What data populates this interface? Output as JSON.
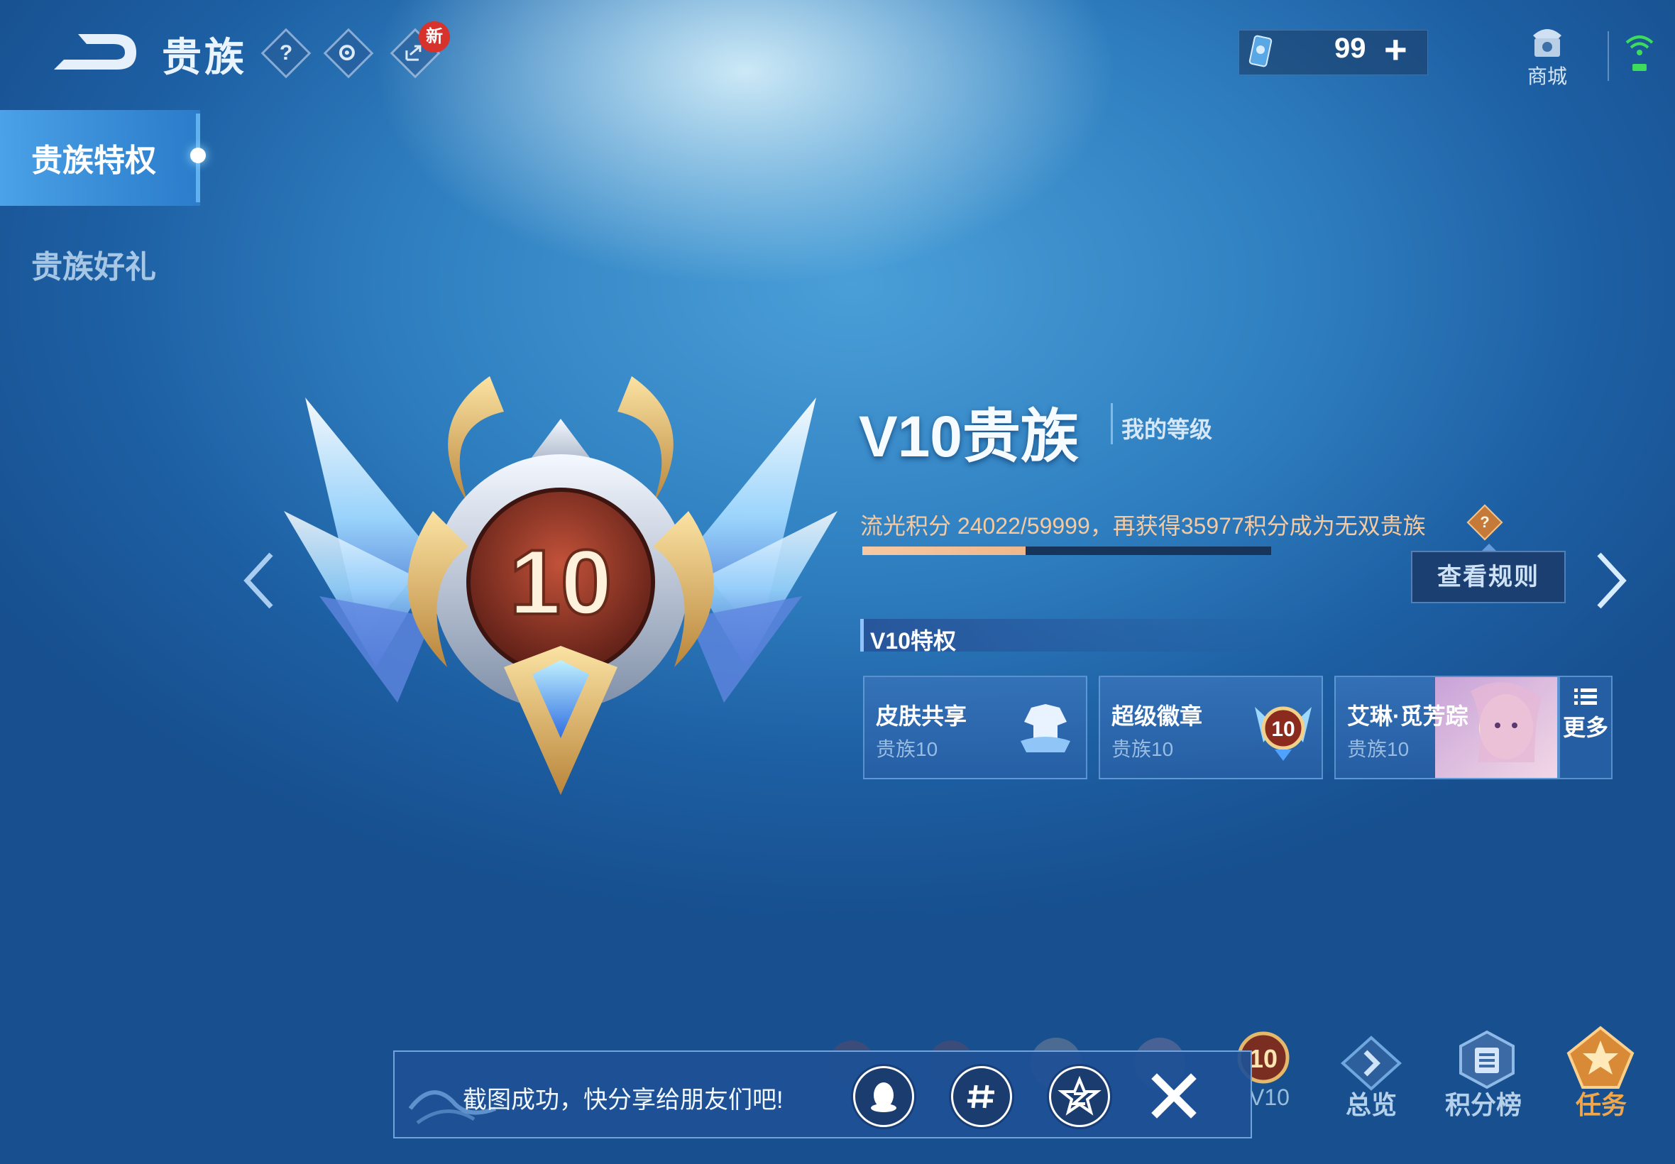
{
  "header": {
    "title": "贵族",
    "help_glyph": "?",
    "new_badge": "新",
    "currency_value": "99",
    "currency_plus": "+",
    "shop_label": "商城"
  },
  "sidebar": {
    "items": [
      {
        "label": "贵族特权",
        "active": true
      },
      {
        "label": "贵族好礼",
        "active": false
      }
    ]
  },
  "emblem": {
    "level": "10"
  },
  "level_info": {
    "title": "V10贵族",
    "my_level": "我的等级",
    "points_text": "流光积分 24022/59999，再获得35977积分成为无双贵族",
    "points_current": 24022,
    "points_target": 59999,
    "progress_fraction": 0.4,
    "help_glyph": "?",
    "rules_button": "查看规则"
  },
  "privileges": {
    "header": "V10特权",
    "cards": [
      {
        "name": "皮肤共享",
        "level": "贵族10"
      },
      {
        "name": "超级徽章",
        "level": "贵族10"
      },
      {
        "name": "艾琳·觅芳踪",
        "level": "贵族10"
      }
    ],
    "more_label": "更多"
  },
  "bottom_nav": {
    "level_strip_label": "V10",
    "badge_level_10": "10",
    "overview": "总览",
    "ranking": "积分榜",
    "task": "任务"
  },
  "toast": {
    "text": "截图成功，快分享给朋友们吧!"
  },
  "colors": {
    "accent_orange": "#f0a64a",
    "points_text": "#f7c99e",
    "progress_fill": "#f6c9a4",
    "badge_red": "#d7322c"
  }
}
